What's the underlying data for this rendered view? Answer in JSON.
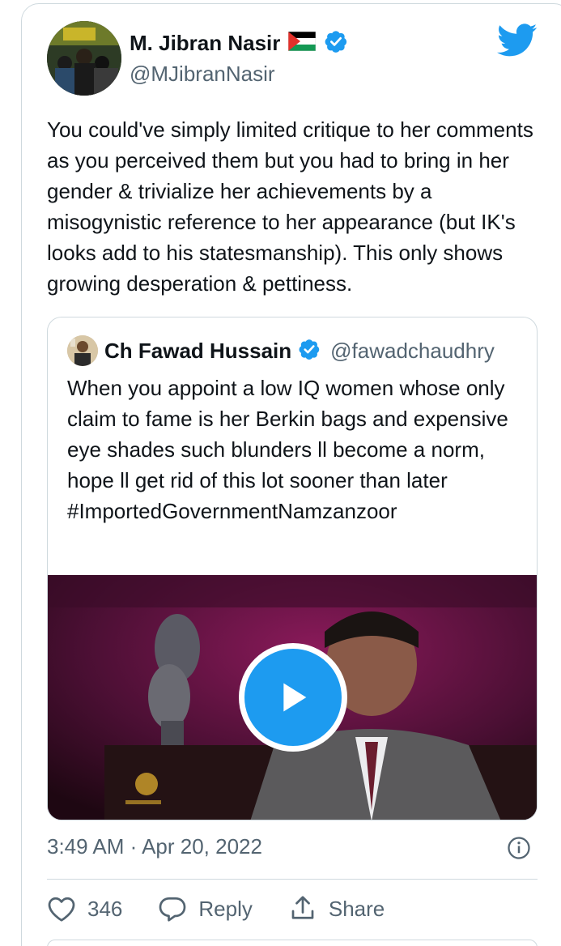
{
  "author": {
    "display_name": "M. Jibran Nasir",
    "handle": "@MJibranNasir",
    "flag_icon": "palestine-flag-icon",
    "verified_icon": "verified-badge-icon"
  },
  "tweet": {
    "text": "You could've simply limited critique to her comments as you perceived them but you had to bring in her gender & trivialize her achievements by a misogynistic reference to her appearance (but IK's looks add to his statesmanship). This only shows growing desperation & pettiness."
  },
  "quoted_tweet": {
    "display_name": "Ch Fawad Hussain",
    "handle": "@fawadchaudhry",
    "text": "When you appoint a low IQ women whose only claim to fame is her Berkin bags and expensive eye shades such blunders ll become a norm, hope ll get rid of this lot sooner than later #ImportedGovernmentNamzanzoor",
    "media": {
      "type": "video",
      "play_icon": "play-icon"
    }
  },
  "meta": {
    "timestamp": "3:49 AM · Apr 20, 2022"
  },
  "actions": {
    "like_count": "346",
    "reply_label": "Reply",
    "share_label": "Share"
  },
  "colors": {
    "accent": "#1d9bf0",
    "text_primary": "#0f1419",
    "text_secondary": "#536471",
    "border": "#cfd9de"
  }
}
